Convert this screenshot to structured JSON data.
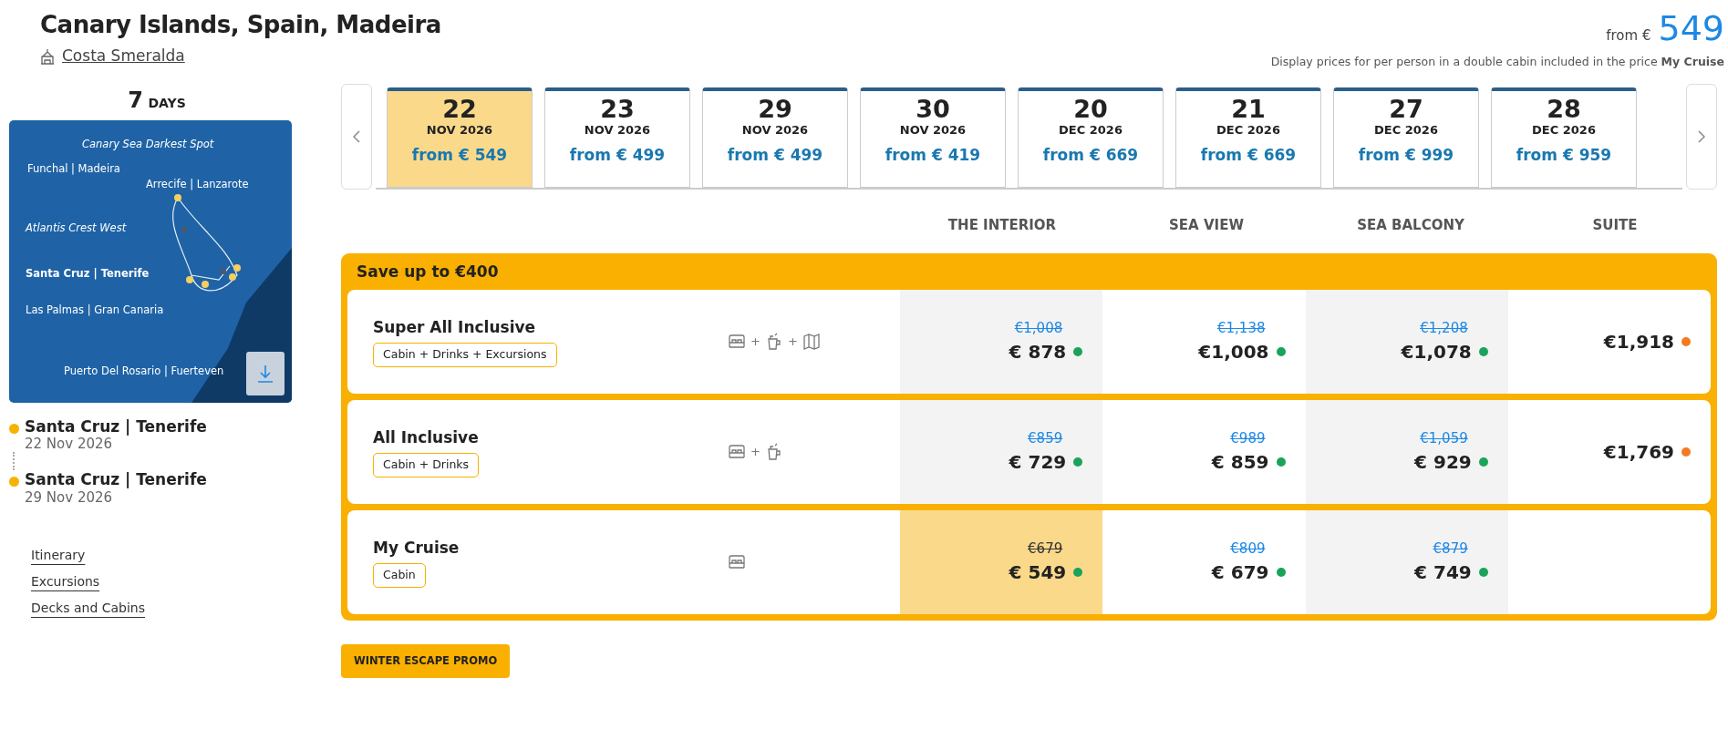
{
  "header": {
    "title": "Canary Islands, Spain, Madeira",
    "ship": "Costa Smeralda",
    "from_label": "from €",
    "from_price": "549",
    "note": "Display prices for per person in a double cabin included in the price **My Cruise**"
  },
  "sidebar": {
    "days_number": "7",
    "days_label": "DAYS",
    "map_labels": [
      {
        "text": "Canary Sea Darkest Spot",
        "kind": "poi"
      },
      {
        "text": "Funchal | Madeira",
        "kind": "port"
      },
      {
        "text": "Arrecife | Lanzarote",
        "kind": "port"
      },
      {
        "text": "Atlantis Crest West",
        "kind": "poi"
      },
      {
        "text": "Santa Cruz | Tenerife",
        "kind": "home"
      },
      {
        "text": "Las Palmas | Gran Canaria",
        "kind": "port"
      },
      {
        "text": "Puerto Del Rosario | Fuerteven",
        "kind": "port"
      }
    ],
    "stops": [
      {
        "port": "Santa Cruz | Tenerife",
        "date": "22 Nov 2026"
      },
      {
        "port": "Santa Cruz | Tenerife",
        "date": "29 Nov 2026"
      }
    ],
    "links": [
      "Itinerary",
      "Excursions",
      "Decks and Cabins"
    ]
  },
  "dates": [
    {
      "day": "22",
      "month": "NOV 2026",
      "price": "from € 549",
      "selected": true
    },
    {
      "day": "23",
      "month": "NOV 2026",
      "price": "from € 499",
      "selected": false
    },
    {
      "day": "29",
      "month": "NOV 2026",
      "price": "from € 499",
      "selected": false
    },
    {
      "day": "30",
      "month": "NOV 2026",
      "price": "from € 419",
      "selected": false
    },
    {
      "day": "20",
      "month": "DEC 2026",
      "price": "from € 669",
      "selected": false
    },
    {
      "day": "21",
      "month": "DEC 2026",
      "price": "from € 669",
      "selected": false
    },
    {
      "day": "27",
      "month": "DEC 2026",
      "price": "from € 999",
      "selected": false
    },
    {
      "day": "28",
      "month": "DEC 2026",
      "price": "from € 959",
      "selected": false
    }
  ],
  "table": {
    "columns": [
      "THE INTERIOR",
      "SEA VIEW",
      "SEA BALCONY",
      "SUITE"
    ],
    "banner": "Save up to €400",
    "rows": [
      {
        "name": "Super All Inclusive",
        "tag": "Cabin + Drinks + Excursions",
        "amenities": [
          {
            "kind": "bed"
          },
          {
            "kind": "plus",
            "text": "+"
          },
          {
            "kind": "drink"
          },
          {
            "kind": "plus",
            "text": "+"
          },
          {
            "kind": "map"
          }
        ],
        "cells": [
          {
            "old": "€1,008",
            "price": "€ 878",
            "color": "#1aa35a",
            "selected": false
          },
          {
            "old": "€1,138",
            "price": "€1,008",
            "color": "#1aa35a",
            "selected": false
          },
          {
            "old": "€1,208",
            "price": "€1,078",
            "color": "#1aa35a",
            "selected": false
          },
          {
            "price": "€1,918",
            "color": "#f47a20",
            "selected": false
          }
        ]
      },
      {
        "name": "All Inclusive",
        "tag": "Cabin + Drinks",
        "amenities": [
          {
            "kind": "bed"
          },
          {
            "kind": "plus",
            "text": "+"
          },
          {
            "kind": "drink"
          }
        ],
        "cells": [
          {
            "old": "€859",
            "price": "€ 729",
            "color": "#1aa35a",
            "selected": false
          },
          {
            "old": "€989",
            "price": "€ 859",
            "color": "#1aa35a",
            "selected": false
          },
          {
            "old": "€1,059",
            "price": "€ 929",
            "color": "#1aa35a",
            "selected": false
          },
          {
            "price": "€1,769",
            "color": "#f47a20",
            "selected": false
          }
        ]
      },
      {
        "name": "My Cruise",
        "tag": "Cabin",
        "amenities": [
          {
            "kind": "bed"
          }
        ],
        "cells": [
          {
            "old": "€679",
            "price": "€ 549",
            "color": "#1aa35a",
            "selected": true
          },
          {
            "old": "€809",
            "price": "€ 679",
            "color": "#1aa35a",
            "selected": false
          },
          {
            "old": "€879",
            "price": "€ 749",
            "color": "#1aa35a",
            "selected": false
          },
          null
        ]
      }
    ]
  },
  "promo": "WINTER ESCAPE PROMO"
}
